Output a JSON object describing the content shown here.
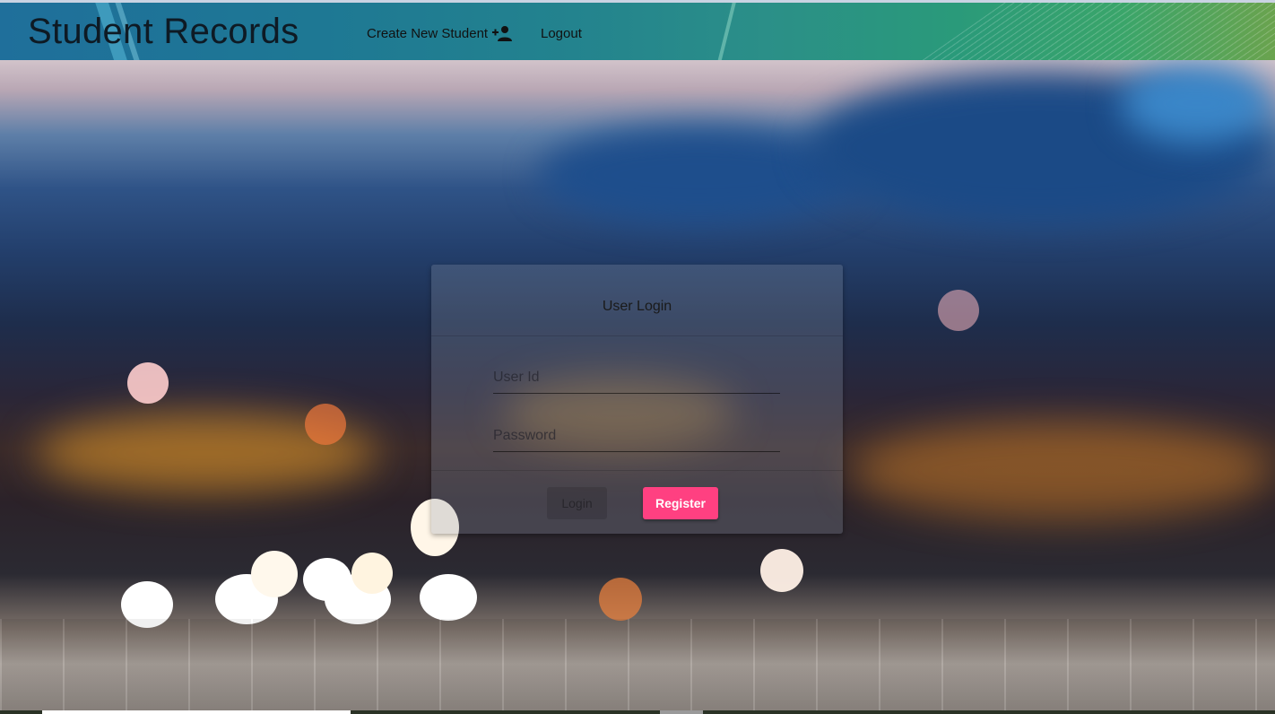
{
  "toolbar": {
    "app_title": "Student Records",
    "create_student_label": "Create New Student",
    "create_student_icon": "person-add-icon",
    "logout_label": "Logout"
  },
  "login_card": {
    "title": "User Login",
    "user_id_placeholder": "User Id",
    "password_placeholder": "Password",
    "login_label": "Login",
    "register_label": "Register",
    "login_enabled": false
  },
  "colors": {
    "accent": "#ff4081",
    "toolbar_start": "#1f6f9b",
    "toolbar_end": "#6aa34e"
  }
}
